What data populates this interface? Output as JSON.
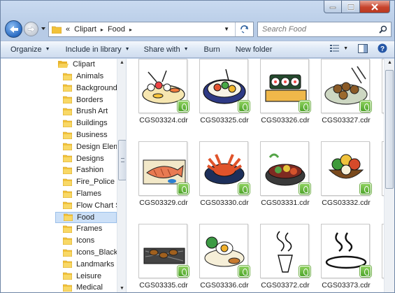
{
  "window": {
    "caption_buttons": [
      "minimize",
      "maximize",
      "close"
    ]
  },
  "address_bar": {
    "overflow": "«",
    "crumbs": [
      "Clipart",
      "Food"
    ],
    "separator": "▸"
  },
  "search": {
    "placeholder": "Search Food"
  },
  "command_bar": {
    "organize": "Organize",
    "include_in_library": "Include in library",
    "share_with": "Share with",
    "burn": "Burn",
    "new_folder": "New folder",
    "dropdown_arrow": "▼"
  },
  "tree": {
    "root": "Clipart",
    "items": [
      "Animals",
      "Backgrounds",
      "Borders",
      "Brush Art",
      "Buildings",
      "Business",
      "Design Elemer",
      "Designs",
      "Fashion",
      "Fire_Police",
      "Flames",
      "Flow Chart Syr",
      "Food",
      "Frames",
      "Icons",
      "Icons_Black_W",
      "Landmarks",
      "Leisure",
      "Medical"
    ],
    "selected": "Food"
  },
  "files": [
    {
      "name": "CGS03324.cdr",
      "icon": "sushi-platter-icon"
    },
    {
      "name": "CGS03325.cdr",
      "icon": "sushi-bowl-icon"
    },
    {
      "name": "CGS03326.cdr",
      "icon": "sushi-roll-icon"
    },
    {
      "name": "CGS03327.cdr",
      "icon": "skewers-plate-icon"
    },
    {
      "name": "CGS03329.cdr",
      "icon": "grilled-fish-icon"
    },
    {
      "name": "CGS03330.cdr",
      "icon": "crab-icon"
    },
    {
      "name": "CGS03331.cdr",
      "icon": "hotpot-icon"
    },
    {
      "name": "CGS03332.cdr",
      "icon": "vegetable-basket-icon"
    },
    {
      "name": "CGS03335.cdr",
      "icon": "grill-skewers-icon"
    },
    {
      "name": "CGS03336.cdr",
      "icon": "egg-dish-icon"
    },
    {
      "name": "CGS03372.cdr",
      "icon": "steam-cup-icon"
    },
    {
      "name": "CGS03373.cdr",
      "icon": "steam-dish-icon"
    }
  ],
  "colors": {
    "selection": "#cce0f7",
    "badge": "#5fb236",
    "folder": "#f2c23a"
  }
}
